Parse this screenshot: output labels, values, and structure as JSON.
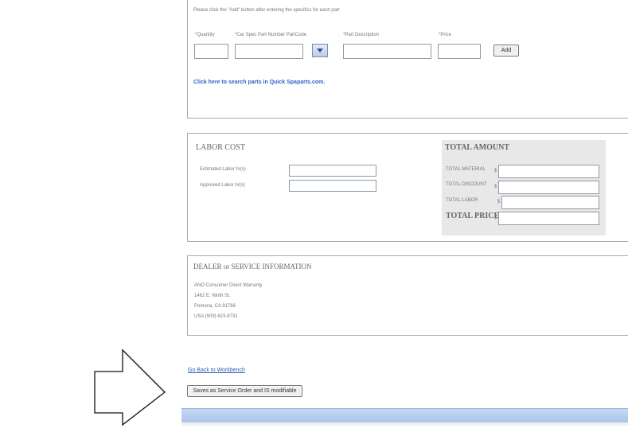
{
  "parts": {
    "instruction": "Please click the \"Add\" button after entering the specifics for each part",
    "quantity_label": "*Quantity",
    "part_number_label": "*Car Spec Part Number PartCode",
    "description_label": "*Part Description",
    "price_label": "*Price",
    "add_label": "Add",
    "search_link": "Click here to search parts in Quick Spaparts.com."
  },
  "labor": {
    "title": "LABOR COST",
    "estimated_label": "Estimated Labor hr(s)",
    "approved_label": "Approved Labor hr(s)"
  },
  "total": {
    "title": "TOTAL AMOUNT",
    "material_label": "TOTAL MATERIAL",
    "discount_label": "TOTAL DISCOUNT",
    "labor_label": "TOTAL LABOR",
    "price_label": "TOTAL PRICE",
    "currency": "$"
  },
  "dealer": {
    "title": "DEALER or SERVICE INFORMATION",
    "line1": "ANO Consumer Direct Warranty",
    "line2": "1462 E. Ninth St.",
    "line3": "Pomona, CA 91766",
    "line4": "USA   (909) 623-8731"
  },
  "footer": {
    "back_link": "Go Back to Workbench",
    "save_label": "Saves as Service Order and IS modifiable"
  }
}
